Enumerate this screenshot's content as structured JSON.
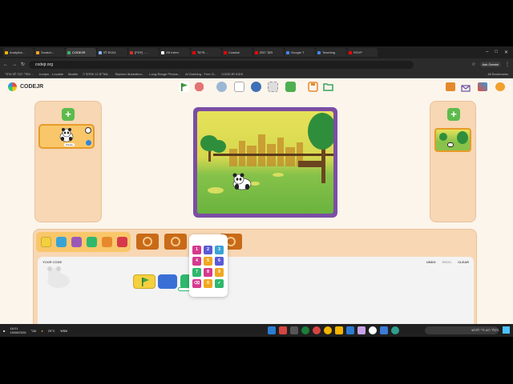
{
  "browser": {
    "tabs": [
      {
        "label": "Analytics -",
        "color": "#f4b400"
      },
      {
        "label": "Scratch -",
        "color": "#f7a825"
      },
      {
        "label": "CODEJR",
        "color": "#3bb26b"
      },
      {
        "label": "בוטים לא",
        "color": "#8ab4f8"
      },
      {
        "label": "[PDF] - ...",
        "color": "#d93025"
      },
      {
        "label": "ZB Interv",
        "color": "#ffffff"
      },
      {
        "label": "מיקוד ...",
        "color": "#ff0000"
      },
      {
        "label": "Coastal",
        "color": "#ff0000"
      },
      {
        "label": "מסך הסק",
        "color": "#ff0000"
      },
      {
        "label": "Google T",
        "color": "#4285f4"
      },
      {
        "label": "Teaching",
        "color": "#4285f4"
      },
      {
        "label": "RSVP",
        "color": "#ff0000"
      }
    ],
    "url": "codejr.org",
    "ask_gemini": "Ask Gemini",
    "bookmarks": [
      "אתרי רבה לנו אתרי ...",
      "Juniper - Lovable",
      "Marble",
      "צעדים 12 שיתוף ה...",
      "Stylized Illustration...",
      "Long-Range Photos...",
      "AI Dubbing - Free O...",
      "CODEJR KIDS"
    ],
    "all_bookmarks": "All Bookmarks"
  },
  "app": {
    "logo_text": "CODEJR",
    "sprite_label": "Panda",
    "code_title": "YOUR CODE",
    "undo": "UNDO",
    "redo": "REDO",
    "clear": "CLEAR",
    "plus": "+",
    "keypad": [
      "1",
      "2",
      "3",
      "4",
      "5",
      "6",
      "7",
      "8",
      "9",
      "⌫",
      "0",
      "✓"
    ],
    "key_colors": [
      "#d63a8e",
      "#5b5bd6",
      "#3aa3d6",
      "#d63a8e",
      "#f0a820",
      "#5b5bd6",
      "#2fb86e",
      "#d63a8e",
      "#f0a820",
      "#d63a8e",
      "#f0a820",
      "#2fb86e"
    ],
    "accent": "#5dbb4d",
    "panel_color": "#f7d7b4"
  },
  "taskbar": {
    "time": "18:21",
    "date": "15/08/2026",
    "lang": "עבר",
    "weather": "29°C",
    "weather_desc": "שמשי",
    "search_placeholder": "הקלד כאן כדי לחפש"
  }
}
